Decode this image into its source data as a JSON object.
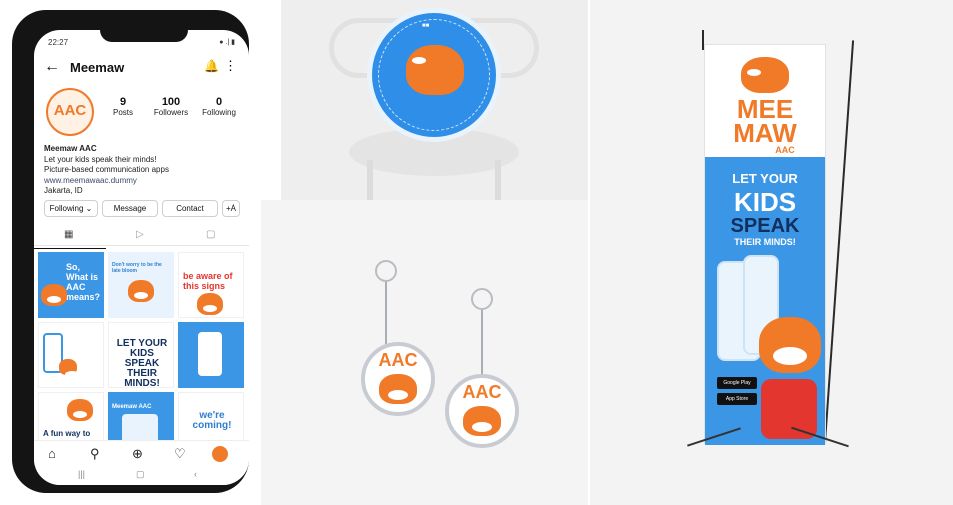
{
  "phone": {
    "status_time": "22:27",
    "username": "Meemaw",
    "avatar_text": "AAC",
    "stats": [
      {
        "num": "9",
        "label": "Posts"
      },
      {
        "num": "100",
        "label": "Followers"
      },
      {
        "num": "0",
        "label": "Following"
      }
    ],
    "bio": {
      "name": "Meemaw AAC",
      "line1": "Let your kids speak their minds!",
      "line2": "Picture-based communication apps",
      "link": "www.meemawaac.dummy",
      "location": "Jakarta, ID"
    },
    "buttons": {
      "following": "Following ⌄",
      "message": "Message",
      "contact": "Contact",
      "add": "+Ȧ"
    },
    "tiles": {
      "t1": "So, What is AAC means?",
      "t2": "Don't worry to be the late bloom",
      "t3": "be aware of this signs",
      "t5": "LET YOUR KIDS SPEAK THEIR MINDS!",
      "t7": "A fun way to communicate",
      "t8": "Meemaw AAC",
      "t9": "we're coming!"
    }
  },
  "keychain": {
    "left_text": "AAC",
    "right_text": "AAC"
  },
  "banner": {
    "logo_line1": "MEE",
    "logo_line2": "MAW",
    "logo_sub": "AAC",
    "tag1": "LET YOUR",
    "tag2": "KIDS",
    "tag3": "SPEAK",
    "tag4": "THEIR MINDS!",
    "store1": "Google Play",
    "store2": "App Store"
  },
  "colors": {
    "brand_orange": "#f07a28",
    "brand_blue": "#3c96e6",
    "navy": "#12305e"
  }
}
